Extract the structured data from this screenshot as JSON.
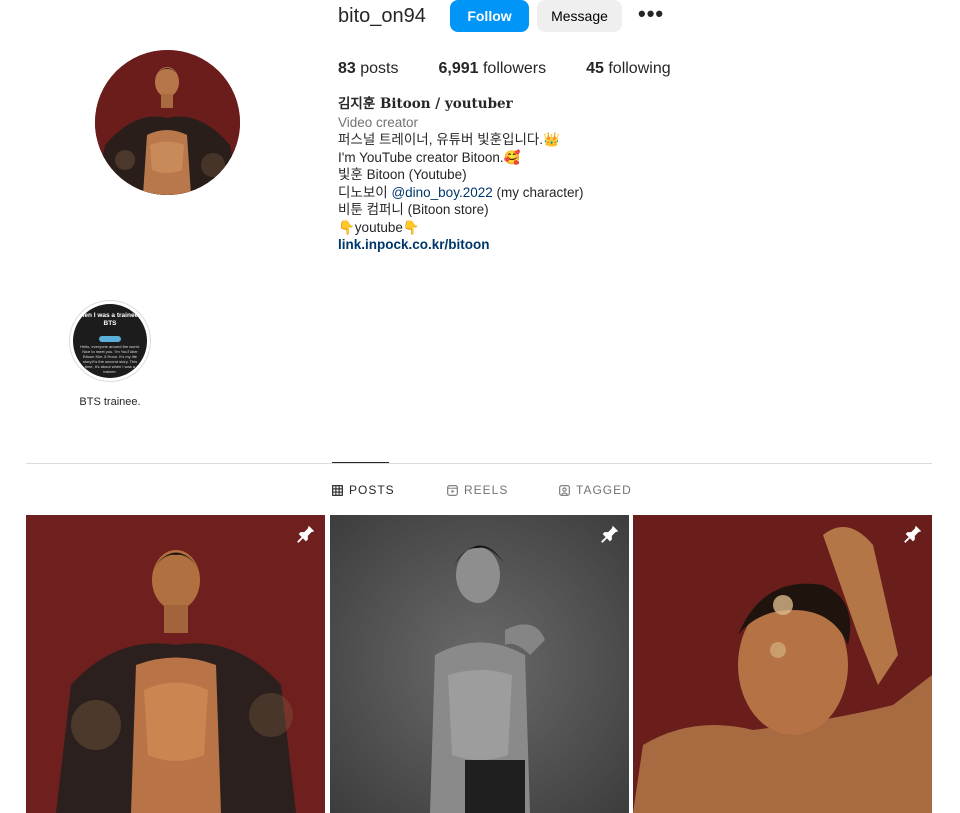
{
  "profile": {
    "username": "bito_on94",
    "follow_label": "Follow",
    "message_label": "Message",
    "more_label": "•••"
  },
  "stats": {
    "posts_count": "83",
    "posts_label": " posts",
    "followers_count": "6,991",
    "followers_label": " followers",
    "following_count": "45",
    "following_label": " following"
  },
  "bio": {
    "name": "김지훈 Bitoon / youtuber",
    "category": "Video creator",
    "line1": "퍼스널 트레이너, 유튜버 빛훈입니다.👑",
    "line2": "I'm YouTube creator Bitoon.🥰",
    "line3": "빛훈 Bitoon (Youtube)",
    "line4_prefix": "디노보이 ",
    "line4_mention": "@dino_boy.2022",
    "line4_suffix": " (my character)",
    "line5": "비툰 컴퍼니 (Bitoon store)",
    "line6": "👇youtube👇",
    "link": "link.inpock.co.kr/bitoon"
  },
  "highlight": {
    "cover_title": "When I was a trainee at BTS",
    "cover_text": "Hello, everyone around the world. Nice to meet you. I'm YouTuber Bitoon Kim Ji Hoon. It's my life story.It's the second story. This time, it's about when I was a trainee.",
    "label": "BTS trainee."
  },
  "tabs": [
    {
      "label": "POSTS",
      "icon": "grid-icon",
      "active": true
    },
    {
      "label": "REELS",
      "icon": "reels-icon",
      "active": false
    },
    {
      "label": "TAGGED",
      "icon": "tagged-icon",
      "active": false
    }
  ],
  "posts": [
    {
      "pinned": true,
      "icon": "pin-icon"
    },
    {
      "pinned": true,
      "icon": "pin-icon"
    },
    {
      "pinned": true,
      "icon": "pin-icon"
    }
  ],
  "colors": {
    "follow_button": "#0095f6",
    "message_button": "#efefef",
    "link": "#00376b",
    "muted": "#737373",
    "divider": "#dbdbdb"
  }
}
